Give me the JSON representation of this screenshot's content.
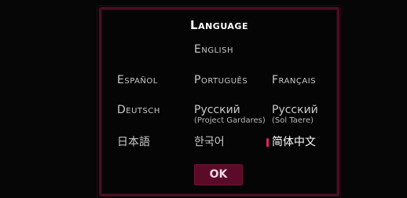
{
  "dialog": {
    "title": "Language",
    "ok_label": "OK"
  },
  "languages": [
    {
      "label": "English",
      "sub": ""
    },
    {
      "label": "Español",
      "sub": ""
    },
    {
      "label": "Português",
      "sub": ""
    },
    {
      "label": "Français",
      "sub": ""
    },
    {
      "label": "Deutsch",
      "sub": ""
    },
    {
      "label": "Русский",
      "sub": "(Project Gardares)"
    },
    {
      "label": "Русский",
      "sub": "(Sol Taere)"
    },
    {
      "label": "日本語",
      "sub": ""
    },
    {
      "label": "한국어",
      "sub": ""
    },
    {
      "label": "简体中文",
      "sub": ""
    }
  ],
  "selected_language": "简体中文",
  "colors": {
    "border": "#4a0f22",
    "accent": "#5b0b28",
    "marker": "#e0245e"
  }
}
